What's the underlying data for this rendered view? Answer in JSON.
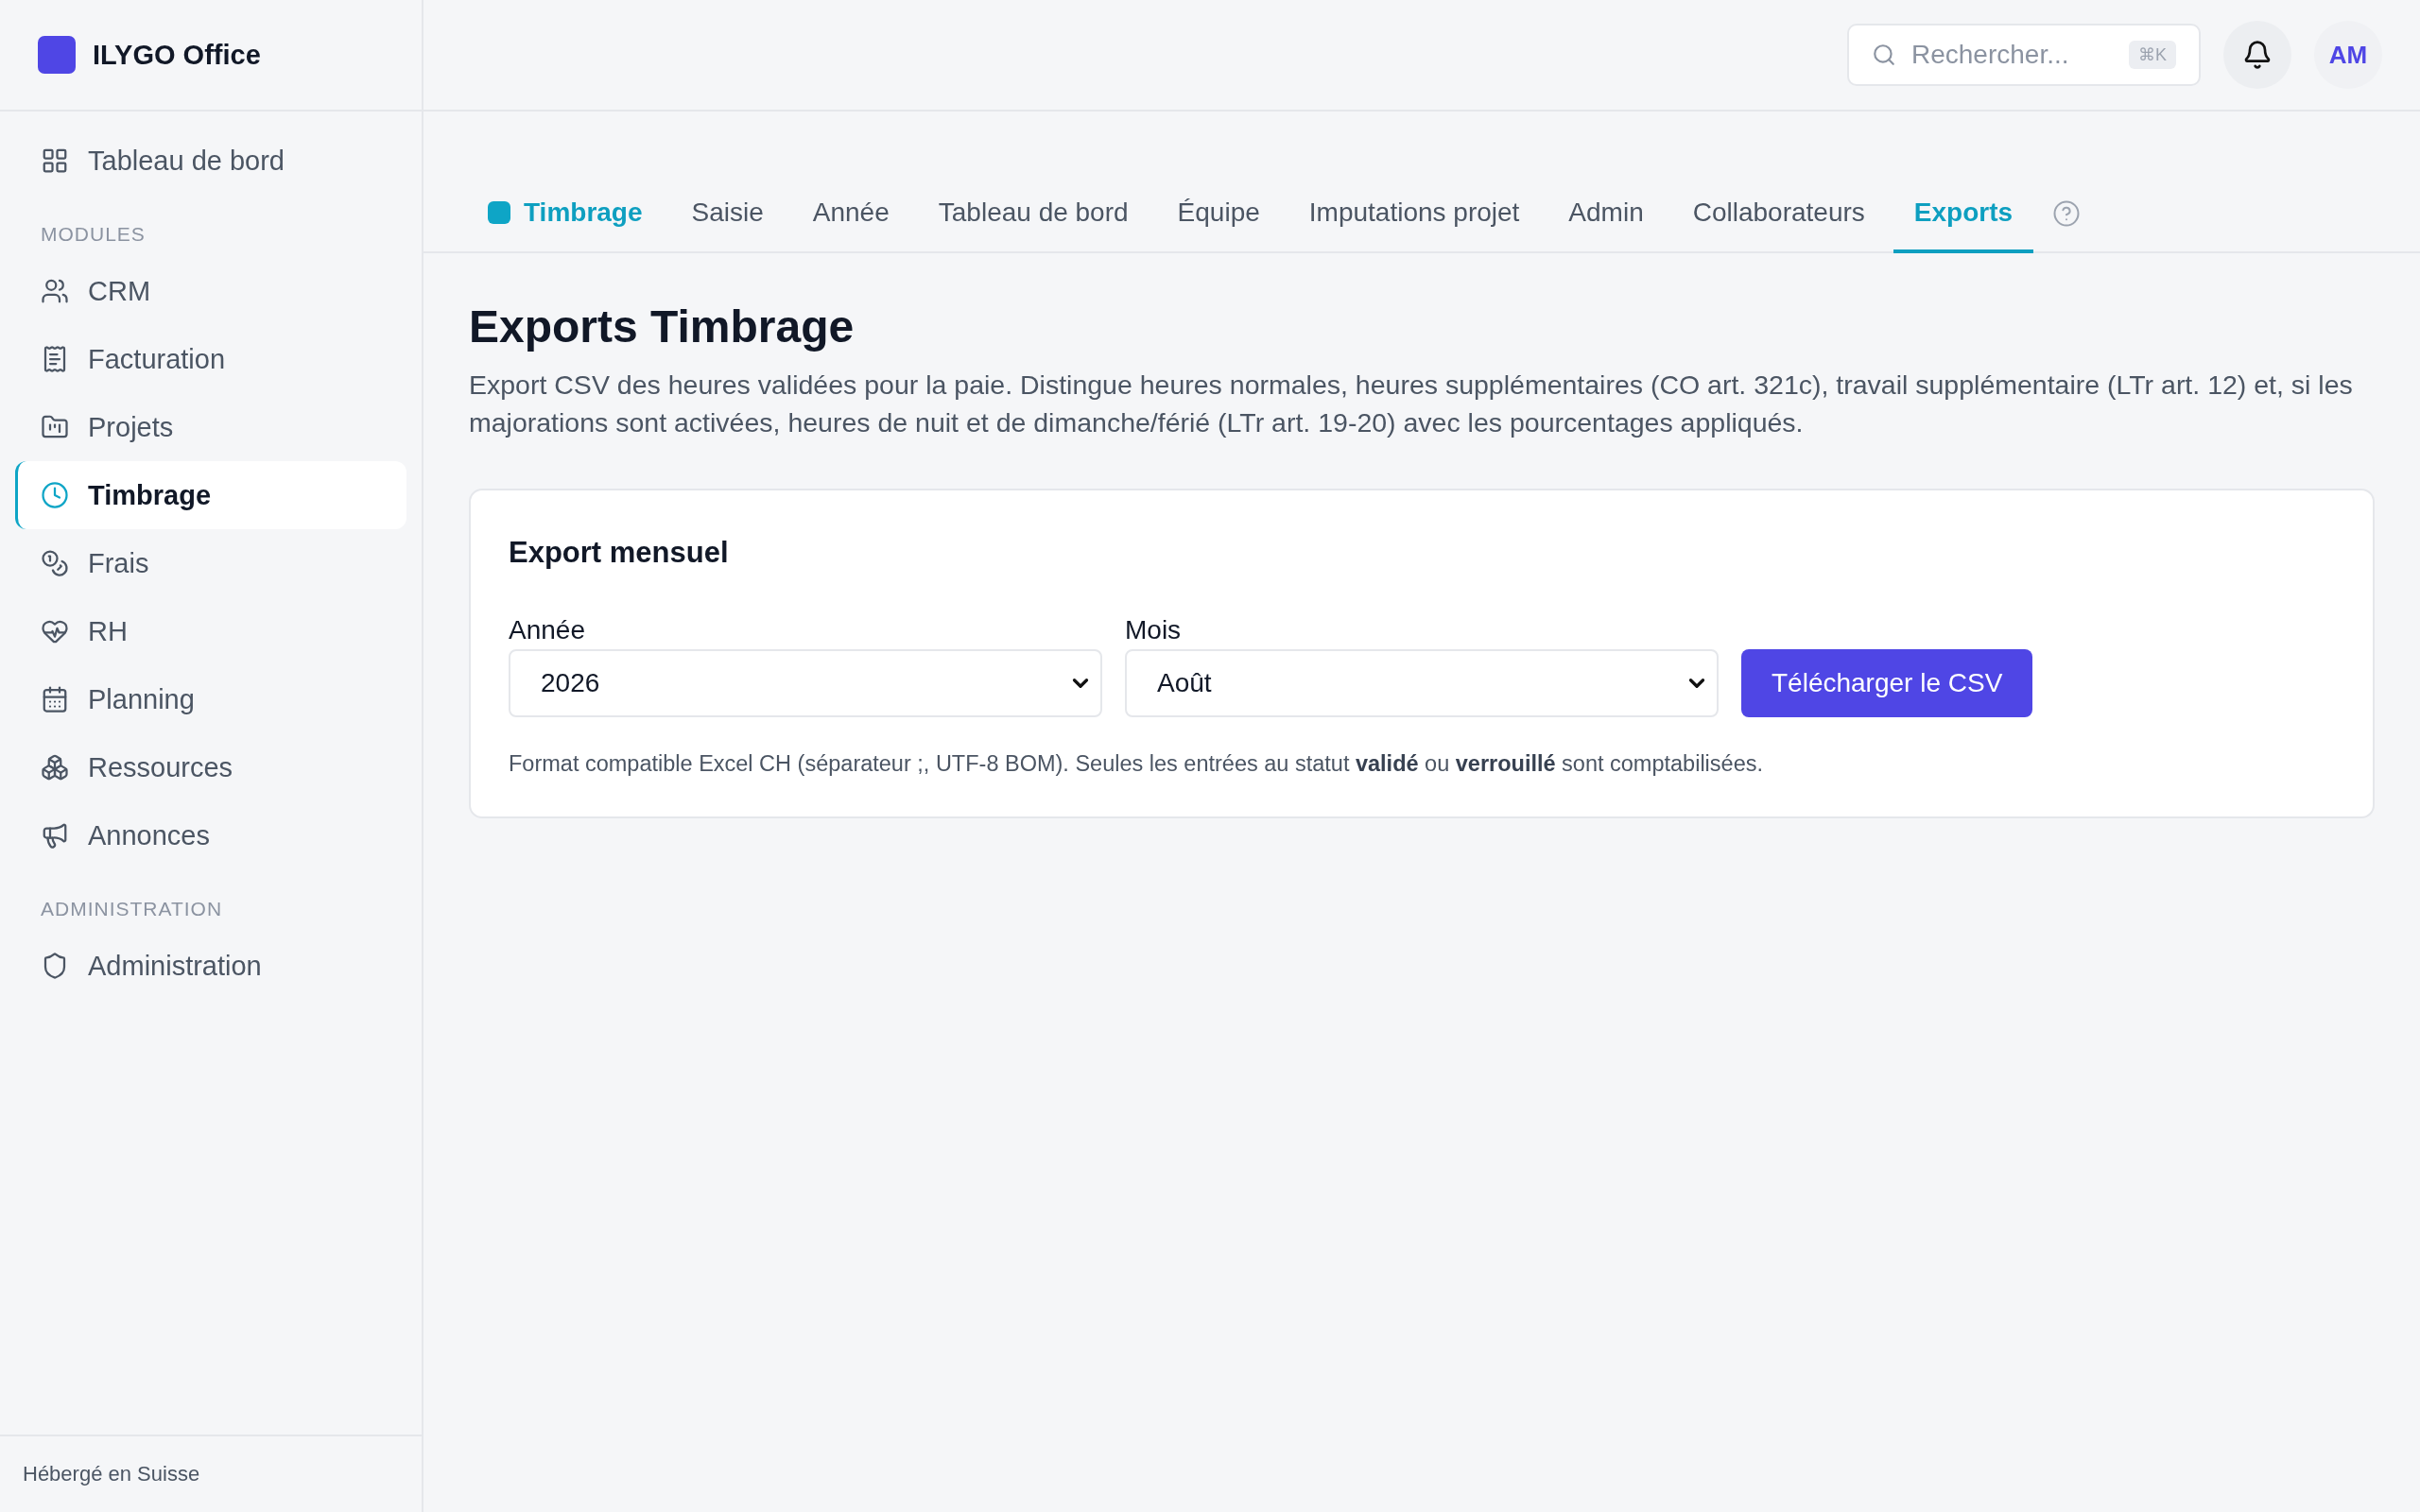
{
  "brand": {
    "name": "ILYGO Office"
  },
  "sidebar": {
    "items": [
      {
        "label": "Tableau de bord",
        "selected": false
      }
    ],
    "sections": [
      {
        "title": "MODULES",
        "items": [
          {
            "label": "CRM",
            "selected": false
          },
          {
            "label": "Facturation",
            "selected": false
          },
          {
            "label": "Projets",
            "selected": false
          },
          {
            "label": "Timbrage",
            "selected": true
          },
          {
            "label": "Frais",
            "selected": false
          },
          {
            "label": "RH",
            "selected": false
          },
          {
            "label": "Planning",
            "selected": false
          },
          {
            "label": "Ressources",
            "selected": false
          },
          {
            "label": "Annonces",
            "selected": false
          }
        ]
      },
      {
        "title": "ADMINISTRATION",
        "items": [
          {
            "label": "Administration",
            "selected": false
          }
        ]
      }
    ],
    "footer": "Hébergé en Suisse"
  },
  "topbar": {
    "search": {
      "placeholder": "Rechercher...",
      "shortcut": "⌘K"
    },
    "avatar": "AM"
  },
  "tabs": [
    {
      "label": "Timbrage",
      "kind": "module"
    },
    {
      "label": "Saisie",
      "kind": "tab",
      "selected": false
    },
    {
      "label": "Année",
      "kind": "tab",
      "selected": false
    },
    {
      "label": "Tableau de bord",
      "kind": "tab",
      "selected": false
    },
    {
      "label": "Équipe",
      "kind": "tab",
      "selected": false
    },
    {
      "label": "Imputations projet",
      "kind": "tab",
      "selected": false
    },
    {
      "label": "Admin",
      "kind": "tab",
      "selected": false
    },
    {
      "label": "Collaborateurs",
      "kind": "tab",
      "selected": false
    },
    {
      "label": "Exports",
      "kind": "tab",
      "selected": true
    }
  ],
  "page": {
    "title": "Exports Timbrage",
    "description": "Export CSV des heures validées pour la paie. Distingue heures normales, heures supplémentaires (CO art. 321c), travail supplémentaire (LTr art. 12) et, si les majorations sont activées, heures de nuit et de dimanche/férié (LTr art. 19-20) avec les pourcentages appliqués."
  },
  "card": {
    "title": "Export mensuel",
    "fields": [
      {
        "label": "Année",
        "value": "2026"
      },
      {
        "label": "Mois",
        "value": "Août"
      }
    ],
    "button": "Télécharger le CSV",
    "note": "Format compatible Excel CH (séparateur ;, UTF-8 BOM). Seules les entrées au statut **validé** ou **verrouillé** sont comptabilisées."
  }
}
